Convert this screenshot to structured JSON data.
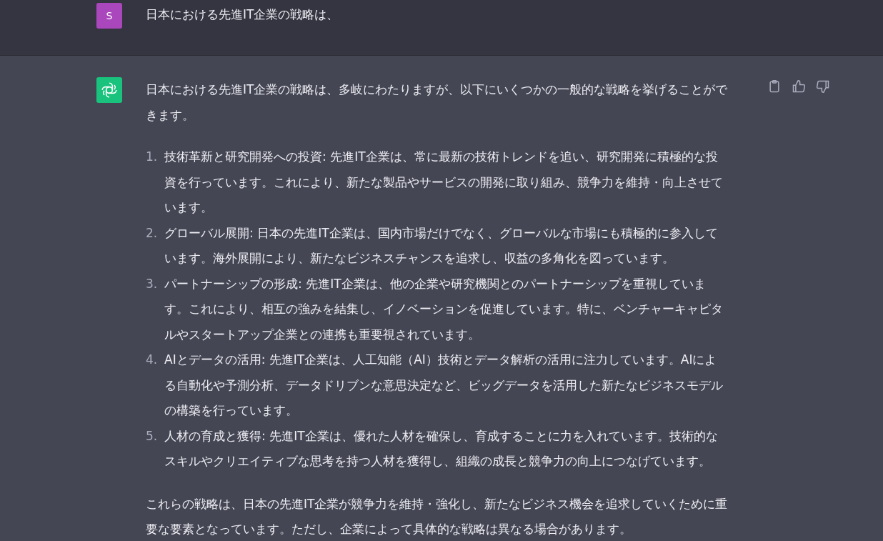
{
  "user_message": {
    "avatar": "S",
    "text": "日本における先進IT企業の戦略は、"
  },
  "assistant_message": {
    "intro": "日本における先進IT企業の戦略は、多岐にわたりますが、以下にいくつかの一般的な戦略を挙げることができます。",
    "items": [
      {
        "number": "1.",
        "text": "技術革新と研究開発への投資: 先進IT企業は、常に最新の技術トレンドを追い、研究開発に積極的な投資を行っています。これにより、新たな製品やサービスの開発に取り組み、競争力を維持・向上させています。"
      },
      {
        "number": "2.",
        "text": "グローバル展開: 日本の先進IT企業は、国内市場だけでなく、グローバルな市場にも積極的に参入しています。海外展開により、新たなビジネスチャンスを追求し、収益の多角化を図っています。"
      },
      {
        "number": "3.",
        "text": "パートナーシップの形成: 先進IT企業は、他の企業や研究機関とのパートナーシップを重視しています。これにより、相互の強みを結集し、イノベーションを促進しています。特に、ベンチャーキャピタルやスタートアップ企業との連携も重要視されています。"
      },
      {
        "number": "4.",
        "text": "AIとデータの活用: 先進IT企業は、人工知能（AI）技術とデータ解析の活用に注力しています。AIによる自動化や予測分析、データドリブンな意思決定など、ビッグデータを活用した新たなビジネスモデルの構築を行っています。"
      },
      {
        "number": "5.",
        "text": "人材の育成と獲得: 先進IT企業は、優れた人材を確保し、育成することに力を入れています。技術的なスキルやクリエイティブな思考を持つ人材を獲得し、組織の成長と競争力の向上につなげています。"
      }
    ],
    "conclusion": "これらの戦略は、日本の先進IT企業が競争力を維持・強化し、新たなビジネス機会を追求していくために重要な要素となっています。ただし、企業によって具体的な戦略は異なる場合があります。"
  }
}
